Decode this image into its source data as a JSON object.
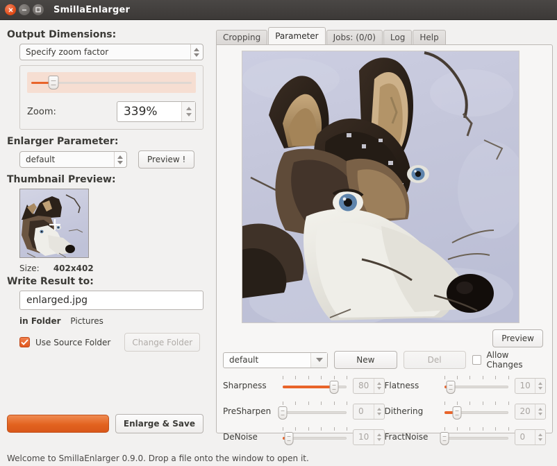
{
  "window": {
    "title": "SmillaEnlarger",
    "controls": [
      "close",
      "minimize",
      "maximize"
    ]
  },
  "left": {
    "output_dimensions_title": "Output Dimensions:",
    "mode_combo": "Specify zoom factor",
    "zoom_label": "Zoom:",
    "zoom_value": "339%",
    "zoom_slider_percent": 14,
    "enlarger_parameter_title": "Enlarger Parameter:",
    "param_combo": "default",
    "preview_button": "Preview !",
    "thumbnail_title": "Thumbnail Preview:",
    "size_label": "Size:",
    "size_value": "402x402",
    "write_result_title": "Write Result to:",
    "filename": "enlarged.jpg",
    "in_folder_label": "in Folder",
    "folder_value": "Pictures",
    "use_source_folder_label": "Use Source Folder",
    "use_source_folder_checked": true,
    "change_folder_button": "Change Folder",
    "change_folder_disabled": true,
    "enlarge_save_button": "Enlarge & Save",
    "progress_percent": 100
  },
  "tabs": [
    {
      "label": "Cropping",
      "active": false
    },
    {
      "label": "Parameter",
      "active": true
    },
    {
      "label": "Jobs: (0/0)",
      "active": false
    },
    {
      "label": "Log",
      "active": false
    },
    {
      "label": "Help",
      "active": false
    }
  ],
  "right": {
    "preview_button": "Preview",
    "preset_combo": "default",
    "new_button": "New",
    "del_button": "Del",
    "del_disabled": true,
    "allow_changes_label": "Allow Changes",
    "allow_changes_checked": false,
    "sliders": [
      {
        "label": "Sharpness",
        "value": "80",
        "percent": 80
      },
      {
        "label": "Flatness",
        "value": "10",
        "percent": 10
      },
      {
        "label": "PreSharpen",
        "value": "0",
        "percent": 0
      },
      {
        "label": "Dithering",
        "value": "20",
        "percent": 20
      },
      {
        "label": "DeNoise",
        "value": "10",
        "percent": 10
      },
      {
        "label": "FractNoise",
        "value": "0",
        "percent": 0
      }
    ]
  },
  "statusbar": {
    "text": "Welcome to SmillaEnlarger 0.9.0.  Drop a file onto the window to open it."
  },
  "colors": {
    "accent_orange": "#e9642a",
    "titlebar": "#3c3937",
    "window_bg": "#f2f1f0",
    "snow": "#c8cade"
  }
}
